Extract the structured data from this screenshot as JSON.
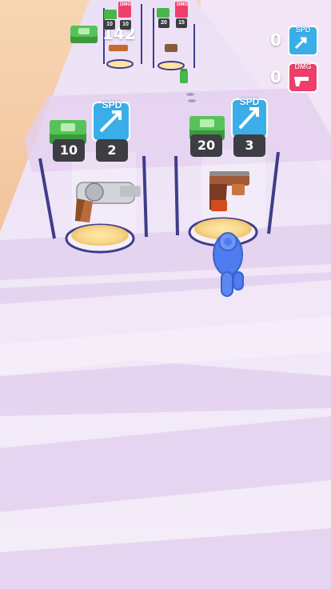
{
  "hud": {
    "money_count": "142",
    "speed_stat": {
      "value": "0",
      "label": "SPD",
      "icon": "rocket-icon"
    },
    "damage_stat": {
      "value": "0",
      "label": "DMG",
      "icon": "gun-icon"
    }
  },
  "near_gates": [
    {
      "money_cost": "10",
      "speed_label": "SPD",
      "speed_value": "2",
      "weapon": "revolver"
    },
    {
      "money_cost": "20",
      "speed_label": "SPD",
      "speed_value": "3",
      "weapon": "wooden-pistol"
    }
  ],
  "far_gates": [
    {
      "money_cost": "10",
      "damage_label": "DMG",
      "damage_value": "10"
    },
    {
      "money_cost": "20",
      "damage_label": "DMG",
      "damage_value": "15"
    }
  ],
  "colors": {
    "sky": "#f0b98a",
    "track": "#efe2f5",
    "stripe": "#e2cdef",
    "post": "#3f3d8a",
    "money": "#49b64a",
    "speed_badge": "#3aaee8",
    "damage_badge": "#ee3f6b",
    "player_hand": "#4f7df0"
  }
}
